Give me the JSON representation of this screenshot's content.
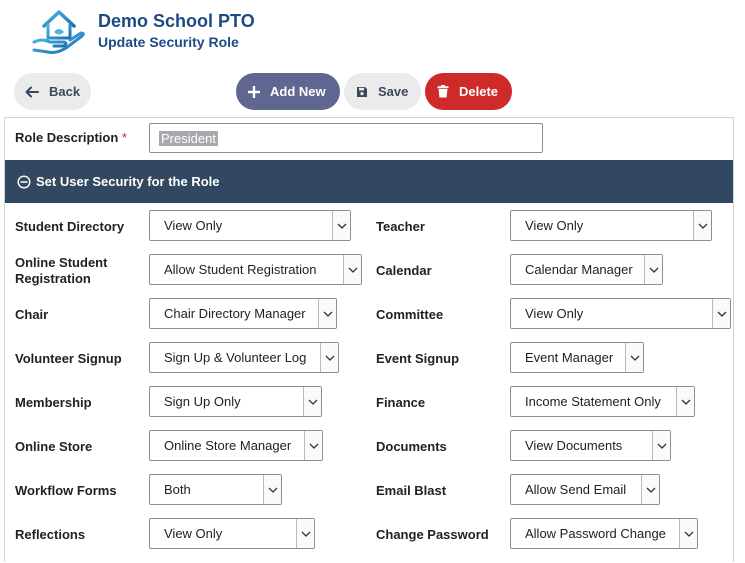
{
  "header": {
    "app_title": "Demo School PTO",
    "page_title": "Update Security Role",
    "logo_icon": "house-in-hand-icon"
  },
  "toolbar": {
    "back_label": "Back",
    "add_label": "Add New",
    "save_label": "Save",
    "delete_label": "Delete"
  },
  "form": {
    "role_description_label": "Role Description",
    "required_marker": "*",
    "role_description_value": "President",
    "section_title": "Set User Security for the Role",
    "fields": [
      {
        "label": "Student Directory",
        "value": "View Only"
      },
      {
        "label": "Teacher",
        "value": "View Only"
      },
      {
        "label": "Online Student Registration",
        "value": "Allow Student Registration"
      },
      {
        "label": "Calendar",
        "value": "Calendar Manager"
      },
      {
        "label": "Chair",
        "value": "Chair Directory Manager"
      },
      {
        "label": "Committee",
        "value": "View Only"
      },
      {
        "label": "Volunteer Signup",
        "value": "Sign Up & Volunteer Log"
      },
      {
        "label": "Event Signup",
        "value": "Event Manager"
      },
      {
        "label": "Membership",
        "value": "Sign Up Only"
      },
      {
        "label": "Finance",
        "value": "Income Statement Only"
      },
      {
        "label": "Online Store",
        "value": "Online Store Manager"
      },
      {
        "label": "Documents",
        "value": "View Documents"
      },
      {
        "label": "Workflow Forms",
        "value": "Both"
      },
      {
        "label": "Email Blast",
        "value": "Allow Send Email"
      },
      {
        "label": "Reflections",
        "value": "View Only"
      },
      {
        "label": "Change Password",
        "value": "Allow Password Change"
      }
    ]
  },
  "colors": {
    "brand": "#1e4a86",
    "section_bar": "#324760",
    "add_button": "#5f6690",
    "delete_button": "#cf2a2a",
    "required": "#d12b2b"
  }
}
